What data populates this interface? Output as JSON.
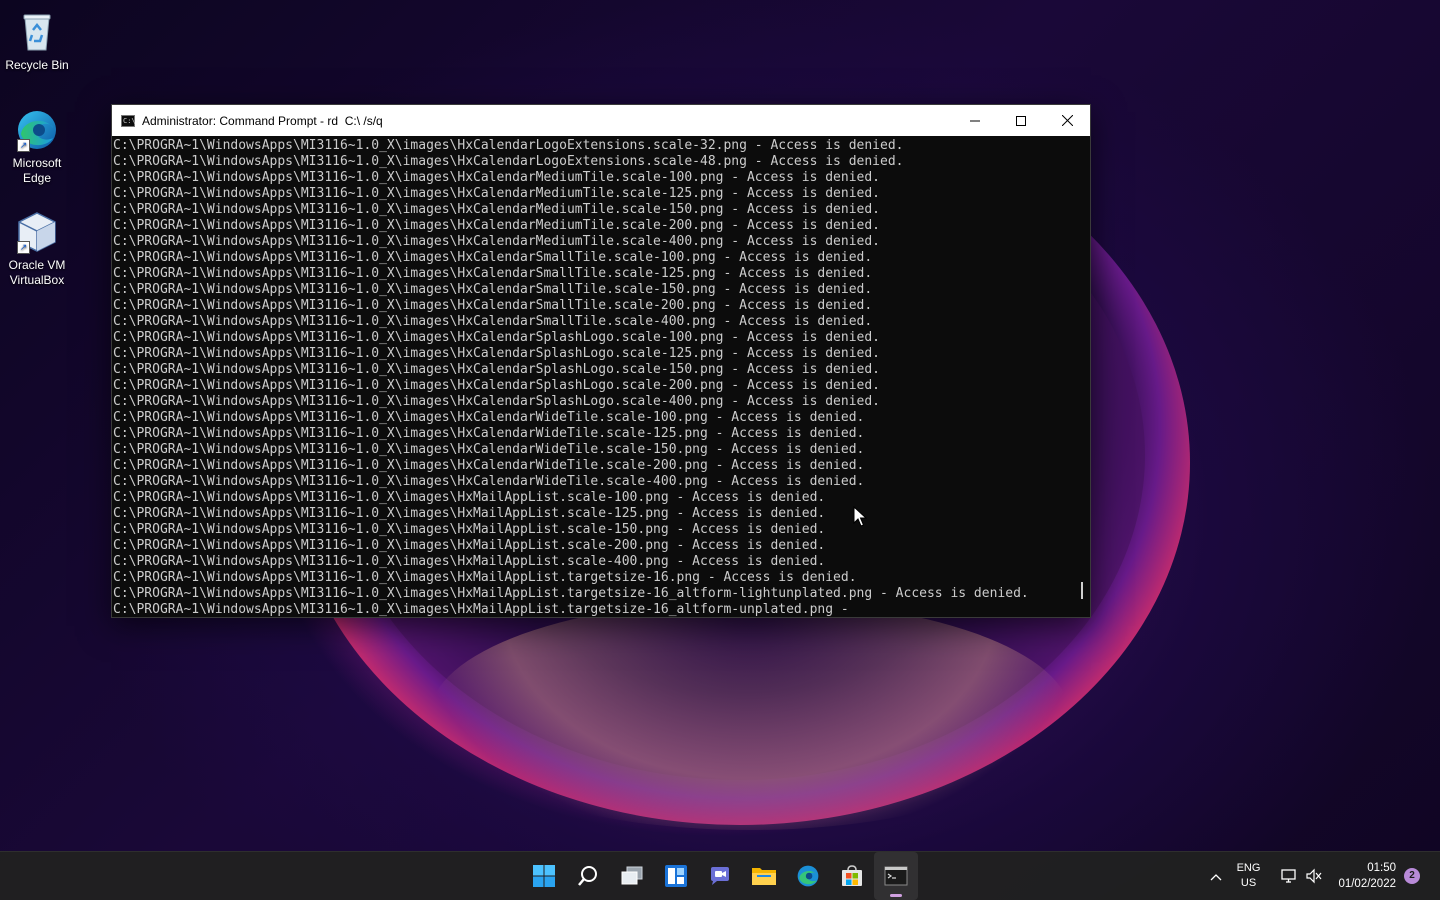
{
  "desktop": {
    "icons": [
      {
        "label": "Recycle Bin"
      },
      {
        "label": "Microsoft Edge"
      },
      {
        "label": "Oracle VM VirtualBox"
      }
    ]
  },
  "window": {
    "title": "Administrator: Command Prompt - rd  C:\\ /s/q",
    "minimize_icon": "minimize-icon",
    "maximize_icon": "maximize-icon",
    "close_icon": "close-icon",
    "lines": [
      "C:\\PROGRA~1\\WindowsApps\\MI3116~1.0_X\\images\\HxCalendarLogoExtensions.scale-32.png - Access is denied.",
      "C:\\PROGRA~1\\WindowsApps\\MI3116~1.0_X\\images\\HxCalendarLogoExtensions.scale-48.png - Access is denied.",
      "C:\\PROGRA~1\\WindowsApps\\MI3116~1.0_X\\images\\HxCalendarMediumTile.scale-100.png - Access is denied.",
      "C:\\PROGRA~1\\WindowsApps\\MI3116~1.0_X\\images\\HxCalendarMediumTile.scale-125.png - Access is denied.",
      "C:\\PROGRA~1\\WindowsApps\\MI3116~1.0_X\\images\\HxCalendarMediumTile.scale-150.png - Access is denied.",
      "C:\\PROGRA~1\\WindowsApps\\MI3116~1.0_X\\images\\HxCalendarMediumTile.scale-200.png - Access is denied.",
      "C:\\PROGRA~1\\WindowsApps\\MI3116~1.0_X\\images\\HxCalendarMediumTile.scale-400.png - Access is denied.",
      "C:\\PROGRA~1\\WindowsApps\\MI3116~1.0_X\\images\\HxCalendarSmallTile.scale-100.png - Access is denied.",
      "C:\\PROGRA~1\\WindowsApps\\MI3116~1.0_X\\images\\HxCalendarSmallTile.scale-125.png - Access is denied.",
      "C:\\PROGRA~1\\WindowsApps\\MI3116~1.0_X\\images\\HxCalendarSmallTile.scale-150.png - Access is denied.",
      "C:\\PROGRA~1\\WindowsApps\\MI3116~1.0_X\\images\\HxCalendarSmallTile.scale-200.png - Access is denied.",
      "C:\\PROGRA~1\\WindowsApps\\MI3116~1.0_X\\images\\HxCalendarSmallTile.scale-400.png - Access is denied.",
      "C:\\PROGRA~1\\WindowsApps\\MI3116~1.0_X\\images\\HxCalendarSplashLogo.scale-100.png - Access is denied.",
      "C:\\PROGRA~1\\WindowsApps\\MI3116~1.0_X\\images\\HxCalendarSplashLogo.scale-125.png - Access is denied.",
      "C:\\PROGRA~1\\WindowsApps\\MI3116~1.0_X\\images\\HxCalendarSplashLogo.scale-150.png - Access is denied.",
      "C:\\PROGRA~1\\WindowsApps\\MI3116~1.0_X\\images\\HxCalendarSplashLogo.scale-200.png - Access is denied.",
      "C:\\PROGRA~1\\WindowsApps\\MI3116~1.0_X\\images\\HxCalendarSplashLogo.scale-400.png - Access is denied.",
      "C:\\PROGRA~1\\WindowsApps\\MI3116~1.0_X\\images\\HxCalendarWideTile.scale-100.png - Access is denied.",
      "C:\\PROGRA~1\\WindowsApps\\MI3116~1.0_X\\images\\HxCalendarWideTile.scale-125.png - Access is denied.",
      "C:\\PROGRA~1\\WindowsApps\\MI3116~1.0_X\\images\\HxCalendarWideTile.scale-150.png - Access is denied.",
      "C:\\PROGRA~1\\WindowsApps\\MI3116~1.0_X\\images\\HxCalendarWideTile.scale-200.png - Access is denied.",
      "C:\\PROGRA~1\\WindowsApps\\MI3116~1.0_X\\images\\HxCalendarWideTile.scale-400.png - Access is denied.",
      "C:\\PROGRA~1\\WindowsApps\\MI3116~1.0_X\\images\\HxMailAppList.scale-100.png - Access is denied.",
      "C:\\PROGRA~1\\WindowsApps\\MI3116~1.0_X\\images\\HxMailAppList.scale-125.png - Access is denied.",
      "C:\\PROGRA~1\\WindowsApps\\MI3116~1.0_X\\images\\HxMailAppList.scale-150.png - Access is denied.",
      "C:\\PROGRA~1\\WindowsApps\\MI3116~1.0_X\\images\\HxMailAppList.scale-200.png - Access is denied.",
      "C:\\PROGRA~1\\WindowsApps\\MI3116~1.0_X\\images\\HxMailAppList.scale-400.png - Access is denied.",
      "C:\\PROGRA~1\\WindowsApps\\MI3116~1.0_X\\images\\HxMailAppList.targetsize-16.png - Access is denied.",
      "C:\\PROGRA~1\\WindowsApps\\MI3116~1.0_X\\images\\HxMailAppList.targetsize-16_altform-lightunplated.png - Access is denied.",
      "C:\\PROGRA~1\\WindowsApps\\MI3116~1.0_X\\images\\HxMailAppList.targetsize-16_altform-unplated.png -"
    ]
  },
  "taskbar": {
    "apps": [
      {
        "name": "start-button",
        "icon": "windows-logo-icon"
      },
      {
        "name": "search-button",
        "icon": "search-icon"
      },
      {
        "name": "task-view-button",
        "icon": "task-view-icon"
      },
      {
        "name": "widgets-button",
        "icon": "widgets-icon"
      },
      {
        "name": "chat-button",
        "icon": "chat-icon"
      },
      {
        "name": "file-explorer-button",
        "icon": "folder-icon"
      },
      {
        "name": "edge-button",
        "icon": "edge-icon"
      },
      {
        "name": "store-button",
        "icon": "store-icon"
      },
      {
        "name": "terminal-button",
        "icon": "terminal-icon",
        "active": true
      }
    ],
    "tray": {
      "lang_top": "ENG",
      "lang_bottom": "US",
      "time": "01:50",
      "date": "01/02/2022",
      "notification_count": "2"
    }
  },
  "colors": {
    "console_bg": "#0c0c0c",
    "console_text": "#cccccc",
    "accent": "#0078d4"
  }
}
